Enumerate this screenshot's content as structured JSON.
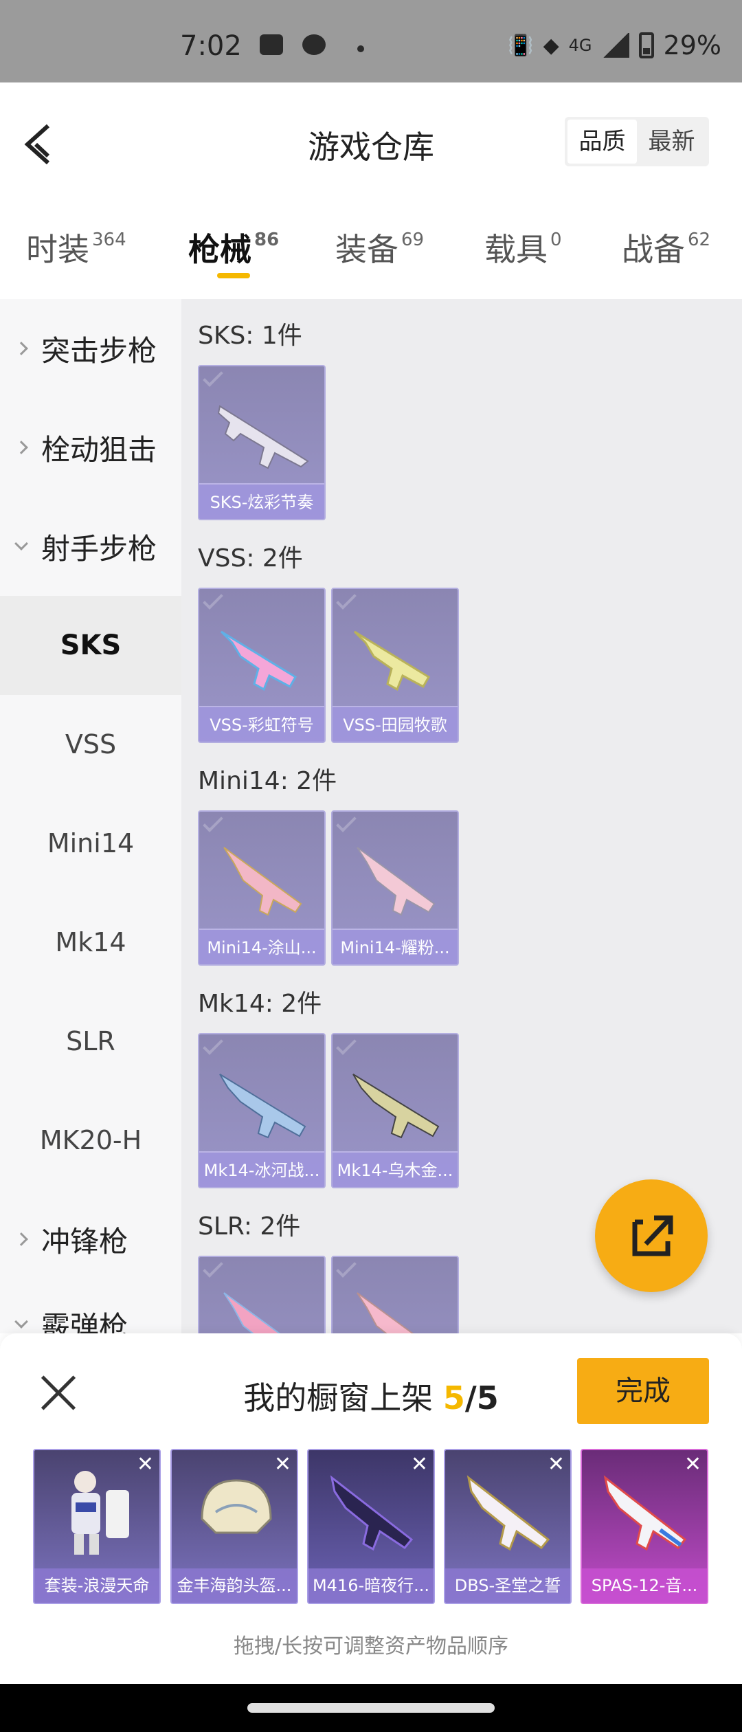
{
  "status_bar": {
    "time": "7:02",
    "network": "4G",
    "battery": "29%"
  },
  "header": {
    "title": "游戏仓库",
    "sort_quality": "品质",
    "sort_newest": "最新"
  },
  "tabs": [
    {
      "label": "时装",
      "count": "364"
    },
    {
      "label": "枪械",
      "count": "86"
    },
    {
      "label": "装备",
      "count": "69"
    },
    {
      "label": "载具",
      "count": "0"
    },
    {
      "label": "战备",
      "count": "62"
    }
  ],
  "sidebar": {
    "categories": [
      "突击步枪",
      "栓动狙击",
      "射手步枪",
      "冲锋枪",
      "霰弹枪"
    ],
    "subitems": [
      "SKS",
      "VSS",
      "Mini14",
      "Mk14",
      "SLR",
      "MK20-H"
    ]
  },
  "sections": [
    {
      "title": "SKS: 1件",
      "items": [
        "SKS-炫彩节奏"
      ]
    },
    {
      "title": "VSS: 2件",
      "items": [
        "VSS-彩虹符号",
        "VSS-田园牧歌"
      ]
    },
    {
      "title": "Mini14: 2件",
      "items": [
        "Mini14-涂山...",
        "Mini14-耀粉..."
      ]
    },
    {
      "title": "Mk14: 2件",
      "items": [
        "Mk14-冰河战...",
        "Mk14-乌木金..."
      ]
    },
    {
      "title": "SLR: 2件",
      "items": [
        "",
        ""
      ]
    }
  ],
  "sheet": {
    "title": "我的橱窗上架",
    "count": "5",
    "total": "/5",
    "done_label": "完成",
    "slots": [
      "套装-浪漫天命",
      "金丰海韵头盔...",
      "M416-暗夜行...",
      "DBS-圣堂之誓",
      "SPAS-12-音..."
    ],
    "hint": "拖拽/长按可调整资产物品顺序"
  },
  "colors": {
    "accent": "#f7ac14",
    "card_purple": "#9a95c8",
    "highlight_yellow": "#f5b800"
  }
}
